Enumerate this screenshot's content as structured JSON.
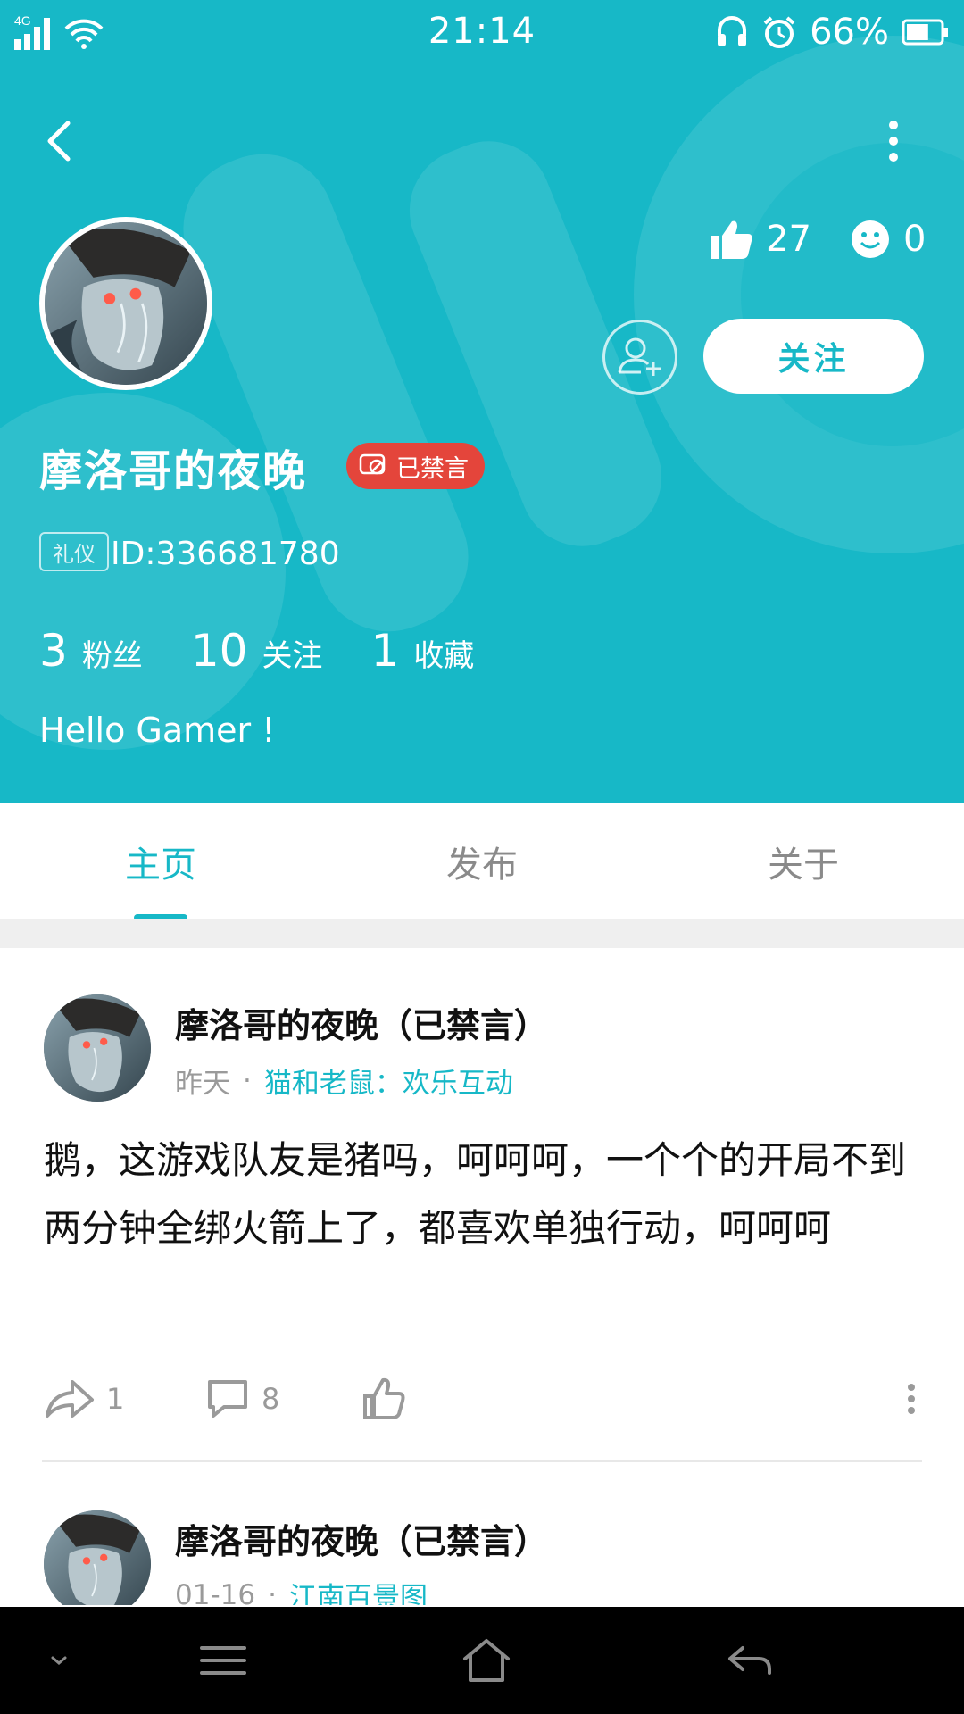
{
  "status_bar": {
    "network": "4G",
    "time": "21:14",
    "battery_percent": "66%",
    "battery_level": 0.66
  },
  "profile": {
    "username": "摩洛哥的夜晚",
    "banned_badge": "已禁言",
    "tag": "礼仪",
    "id_text": "ID:336681780",
    "likes_count": "27",
    "moods_count": "0",
    "follow_label": "关注",
    "stats": [
      {
        "num": "3",
        "label": "粉丝"
      },
      {
        "num": "10",
        "label": "关注"
      },
      {
        "num": "1",
        "label": "收藏"
      }
    ],
    "bio": "Hello Gamer !"
  },
  "tabs": [
    {
      "label": "主页",
      "active": true
    },
    {
      "label": "发布",
      "active": false
    },
    {
      "label": "关于",
      "active": false
    }
  ],
  "posts": [
    {
      "author": "摩洛哥的夜晚（已禁言）",
      "time": "昨天",
      "separator": "·",
      "topic": "猫和老鼠：欢乐互动",
      "content": "鹅，这游戏队友是猪吗，呵呵呵，一个个的开局不到两分钟全绑火箭上了，都喜欢单独行动，呵呵呵",
      "shares": "1",
      "comments": "8"
    },
    {
      "author": "摩洛哥的夜晚（已禁言）",
      "time": "01-16",
      "separator": "·",
      "topic": "江南百景图"
    }
  ],
  "colors": {
    "accent": "#17b8c7",
    "banned": "#e4453b",
    "nav_bar": "#000000"
  }
}
